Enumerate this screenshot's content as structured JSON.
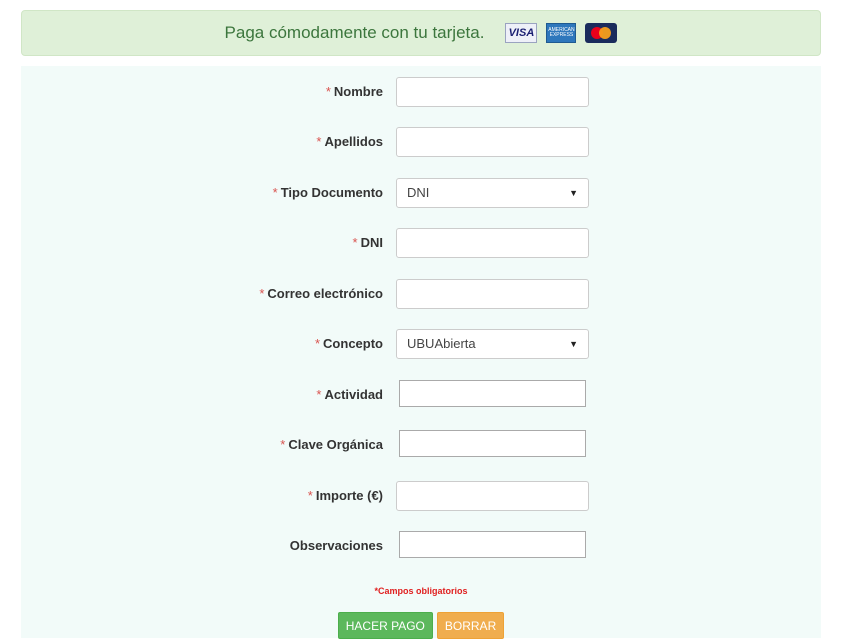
{
  "banner": {
    "text": "Paga cómodamente con tu tarjeta.",
    "cards": [
      {
        "name": "visa-card-icon",
        "label": "VISA"
      },
      {
        "name": "amex-card-icon",
        "label": "AMERICAN EXPRESS"
      },
      {
        "name": "mastercard-card-icon",
        "label": ""
      }
    ],
    "color": "#dff0d8",
    "text_color": "#3c763d"
  },
  "form": {
    "required_marker": "*",
    "fields": [
      {
        "label": "Nombre",
        "required": true,
        "type": "text",
        "value": ""
      },
      {
        "label": "Apellidos",
        "required": true,
        "type": "text",
        "value": ""
      },
      {
        "label": "Tipo Documento",
        "required": true,
        "type": "select",
        "value": "DNI"
      },
      {
        "label": "DNI",
        "required": true,
        "type": "text",
        "value": ""
      },
      {
        "label": "Correo electrónico",
        "required": true,
        "type": "text",
        "value": ""
      },
      {
        "label": "Concepto",
        "required": true,
        "type": "select",
        "value": "UBUAbierta"
      },
      {
        "label": "Actividad",
        "required": true,
        "type": "text",
        "value": ""
      },
      {
        "label": "Clave Orgánica",
        "required": true,
        "type": "text",
        "value": ""
      },
      {
        "label": "Importe (€)",
        "required": true,
        "type": "text",
        "value": ""
      },
      {
        "label": "Observaciones",
        "required": false,
        "type": "text",
        "value": ""
      }
    ],
    "required_note": "*Campos obligatorios",
    "background": "#f2fbf9"
  },
  "buttons": {
    "submit": "HACER PAGO",
    "reset": "BORRAR",
    "submit_color": "#5cb85c",
    "reset_color": "#f0ad4e"
  }
}
